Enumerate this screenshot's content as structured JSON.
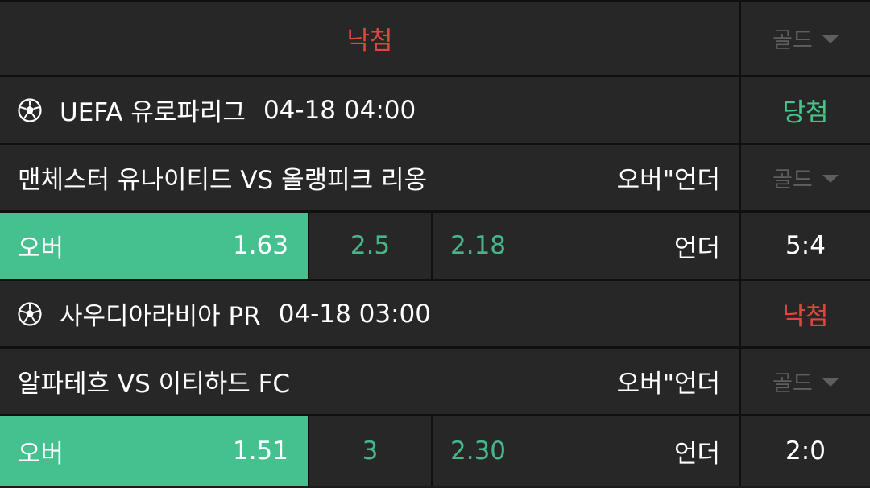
{
  "top_row": {
    "status": "낙첨",
    "gold_label": "골드"
  },
  "matches": [
    {
      "league": "UEFA 유로파리그",
      "datetime": "04-18 04:00",
      "result": "당첨",
      "title": "맨체스터 유나이티드 VS 올랭피크 리옹",
      "market": "오버\"언더",
      "gold_label": "골드",
      "over_label": "오버",
      "over_odds": "1.63",
      "line": "2.5",
      "under_odds": "2.18",
      "under_label": "언더",
      "score": "5:4"
    },
    {
      "league": "사우디아라비아 PR",
      "datetime": "04-18 03:00",
      "result": "낙첨",
      "title": "알파테흐 VS 이티하드 FC",
      "market": "오버\"언더",
      "gold_label": "골드",
      "over_label": "오버",
      "over_odds": "1.51",
      "line": "3",
      "under_odds": "2.30",
      "under_label": "언더",
      "score": "2:0"
    }
  ],
  "colors": {
    "win": "#44c58a",
    "lose": "#e0453f",
    "selected": "#45c08f",
    "muted": "#5f5f5f",
    "background": "#272727"
  },
  "icons": {
    "sport": "soccer-ball-icon",
    "dropdown": "caret-down-icon"
  }
}
